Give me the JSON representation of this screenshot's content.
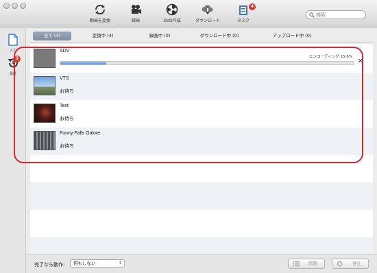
{
  "toolbar": {
    "buttons": [
      {
        "label": "動画を変換",
        "icon": "convert-icon"
      },
      {
        "label": "録画",
        "icon": "video-camera-icon"
      },
      {
        "label": "DVD作成",
        "icon": "dvd-burn-icon"
      },
      {
        "label": "ダウンロード",
        "icon": "cloud-download-icon"
      },
      {
        "label": "タスク",
        "icon": "task-clipboard-icon",
        "badge": "4"
      }
    ],
    "search_placeholder": "検索"
  },
  "sidebar": {
    "items": [
      {
        "label": "入力",
        "icon": "document-icon"
      },
      {
        "label": "履歴",
        "icon": "history-icon",
        "badge": "5"
      }
    ]
  },
  "tabs": [
    {
      "label": "全て (4)",
      "active": true
    },
    {
      "label": "変換中 (4)",
      "active": false
    },
    {
      "label": "録画中 (0)",
      "active": false
    },
    {
      "label": "ダウンロード中 (0)",
      "active": false
    },
    {
      "label": "アップロード中 (0)",
      "active": false
    }
  ],
  "tasks": [
    {
      "title": "SDV",
      "status": "エンコーディング 15.6%",
      "progress": 0.156,
      "thumb": "gray"
    },
    {
      "title": "VTS",
      "status": "お待ち",
      "thumb": "sky"
    },
    {
      "title": "Test",
      "status": "お待ち",
      "thumb": "dark"
    },
    {
      "title": "Funny Falls Galore",
      "status": "お待ち",
      "thumb": "photo"
    }
  ],
  "bottom": {
    "after_label": "完了なら動作:",
    "after_value": "何もしない",
    "delete_label": "削除",
    "stop_label": "停止"
  },
  "colors": {
    "highlight": "#d7262c",
    "badge": "#e23a2a",
    "progress": "#5b90d2"
  }
}
